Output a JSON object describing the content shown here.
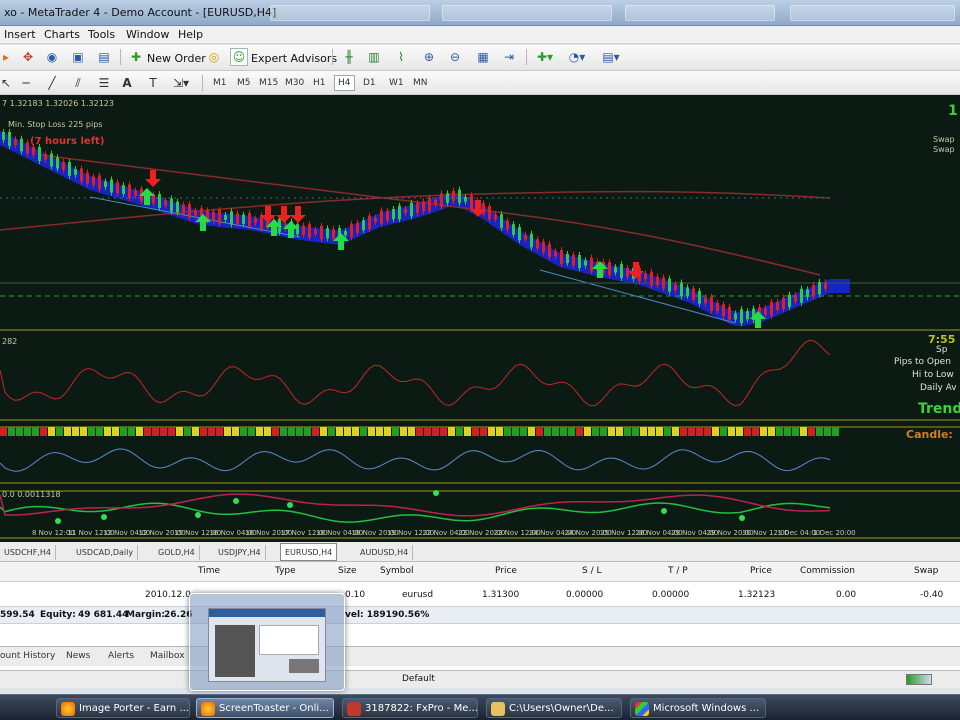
{
  "window": {
    "title": "xo - MetaTrader 4 - Demo Account - [EURUSD,H4]"
  },
  "menu": [
    "Insert",
    "Charts",
    "Tools",
    "Window",
    "Help"
  ],
  "toolbar": {
    "new_order_label": "New Order",
    "expert_advisors_label": "Expert Advisors",
    "timeframes": [
      "M1",
      "M5",
      "M15",
      "M30",
      "H1",
      "H4",
      "D1",
      "W1",
      "MN"
    ],
    "active_timeframe": "H4"
  },
  "chart": {
    "header_text": "7 1.32183 1.32026 1.32123",
    "stop_loss_text": "Min. Stop Loss  225 pips",
    "hours_left_text": "(7 hours left)",
    "right_top_value": "1",
    "right_swap_1": "Swap",
    "right_swap_2": "Swap",
    "indicator_value": "282",
    "right_panel": {
      "line1": "7:55",
      "line2": "Sp",
      "line3": "Pips to Open",
      "line4": "Hi to Low",
      "line5": "Daily Av",
      "trend": "Trend",
      "candle": "Candle:"
    },
    "lower_indicator_label": "0.0 0.0011318",
    "time_axis": [
      "8 Nov 12:00",
      "11 Nov 12:00",
      "12 Nov 04:00",
      "12 Nov 20:00",
      "15 Nov 12:00",
      "16 Nov 04:00",
      "16 Nov 20:00",
      "17 Nov 12:00",
      "18 Nov 04:00",
      "18 Nov 20:00",
      "19 Nov 12:00",
      "22 Nov 04:00",
      "22 Nov 20:00",
      "23 Nov 12:00",
      "24 Nov 04:00",
      "24 Nov 20:00",
      "25 Nov 12:00",
      "26 Nov 04:00",
      "29 Nov 04:00",
      "29 Nov 20:00",
      "30 Nov 12:00",
      "1 Dec 04:00",
      "1 Dec 20:00"
    ],
    "colors": {
      "background": "#0c1a14",
      "bull_candle": "#2ecc40",
      "bear_candle": "#e02020",
      "up_arrow": "#22dd44",
      "down_arrow": "#ee2020",
      "ma_line": "#8a2a2a",
      "band": "#1a28ff",
      "separator": "#9a9a20"
    }
  },
  "chart_tabs": [
    "USDCHF,H4",
    "USDCAD,Daily",
    "GOLD,H4",
    "USDJPY,H4",
    "EURUSD,H4",
    "AUDUSD,H4"
  ],
  "active_chart_tab": "EURUSD,H4",
  "terminal": {
    "headers": [
      "Time",
      "Type",
      "Size",
      "Symbol",
      "Price",
      "S / L",
      "T / P",
      "Price",
      "Commission",
      "Swap"
    ],
    "row": {
      "time": "2010.12.0",
      "size": "0.10",
      "symbol": "eurusd",
      "price": "1.31300",
      "sl": "0.00000",
      "tp": "0.00000",
      "cur_price": "1.32123",
      "commission": "0.00",
      "swap": "-0.40"
    },
    "balance_line": {
      "balance": "599.54",
      "equity_label": "Equity:",
      "equity": "49 681.44",
      "margin_label": "Margin:",
      "margin": "26.26",
      "level": "vel: 189190.56%"
    },
    "tabs": [
      "ount History",
      "News",
      "Alerts",
      "Mailbox"
    ]
  },
  "status": {
    "profile": "Default"
  },
  "taskbar": [
    {
      "label": "Image Porter - Earn ..."
    },
    {
      "label": "ScreenToaster - Onli..."
    },
    {
      "label": "3187822: FxPro - Me..."
    },
    {
      "label": "C:\\Users\\Owner\\De..."
    },
    {
      "label": "Microsoft Windows ..."
    }
  ]
}
